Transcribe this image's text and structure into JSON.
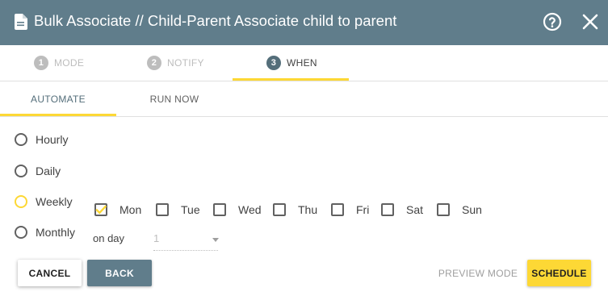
{
  "header": {
    "title": "Bulk Associate // Child-Parent Associate child to parent",
    "icons": [
      "document-icon",
      "help-icon",
      "close-icon"
    ]
  },
  "steps": [
    {
      "number": "1",
      "label": "MODE",
      "state": "inactive"
    },
    {
      "number": "2",
      "label": "NOTIFY",
      "state": "inactive"
    },
    {
      "number": "3",
      "label": "WHEN",
      "state": "active"
    }
  ],
  "tabs": [
    {
      "label": "AUTOMATE",
      "active": true
    },
    {
      "label": "RUN NOW",
      "active": false
    }
  ],
  "frequency": {
    "options": [
      "Hourly",
      "Daily",
      "Weekly",
      "Monthly"
    ],
    "selected": "Weekly"
  },
  "days": [
    {
      "label": "Mon",
      "checked": true
    },
    {
      "label": "Tue",
      "checked": false
    },
    {
      "label": "Wed",
      "checked": false
    },
    {
      "label": "Thu",
      "checked": false
    },
    {
      "label": "Fri",
      "checked": false
    },
    {
      "label": "Sat",
      "checked": false
    },
    {
      "label": "Sun",
      "checked": false
    }
  ],
  "monthly": {
    "label": "on day",
    "value": "1"
  },
  "buttons": {
    "cancel": "CANCEL",
    "back": "BACK",
    "preview": "PREVIEW MODE",
    "schedule": "SCHEDULE"
  },
  "colors": {
    "header": "#607d8b",
    "accent": "#fdd835",
    "active_step": "#546e7a"
  }
}
